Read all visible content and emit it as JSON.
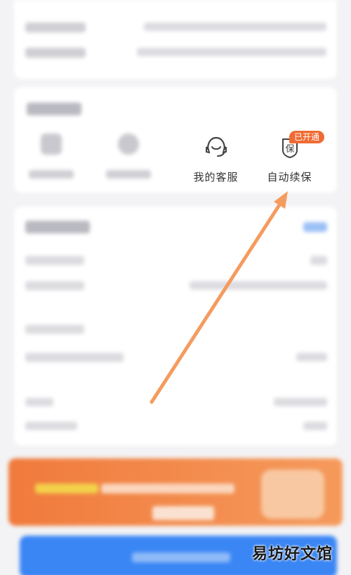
{
  "services": {
    "items": [
      {
        "label": "我的客服",
        "icon": "headset-icon"
      },
      {
        "label": "自动续保",
        "icon": "shield-bao-icon"
      }
    ],
    "auto_renew_badge": "已开通"
  },
  "watermark": "易坊好文馆",
  "colors": {
    "accent_orange": "#ef6b33",
    "arrow_orange": "#f59b5f",
    "primary_blue": "#3a86f5"
  }
}
